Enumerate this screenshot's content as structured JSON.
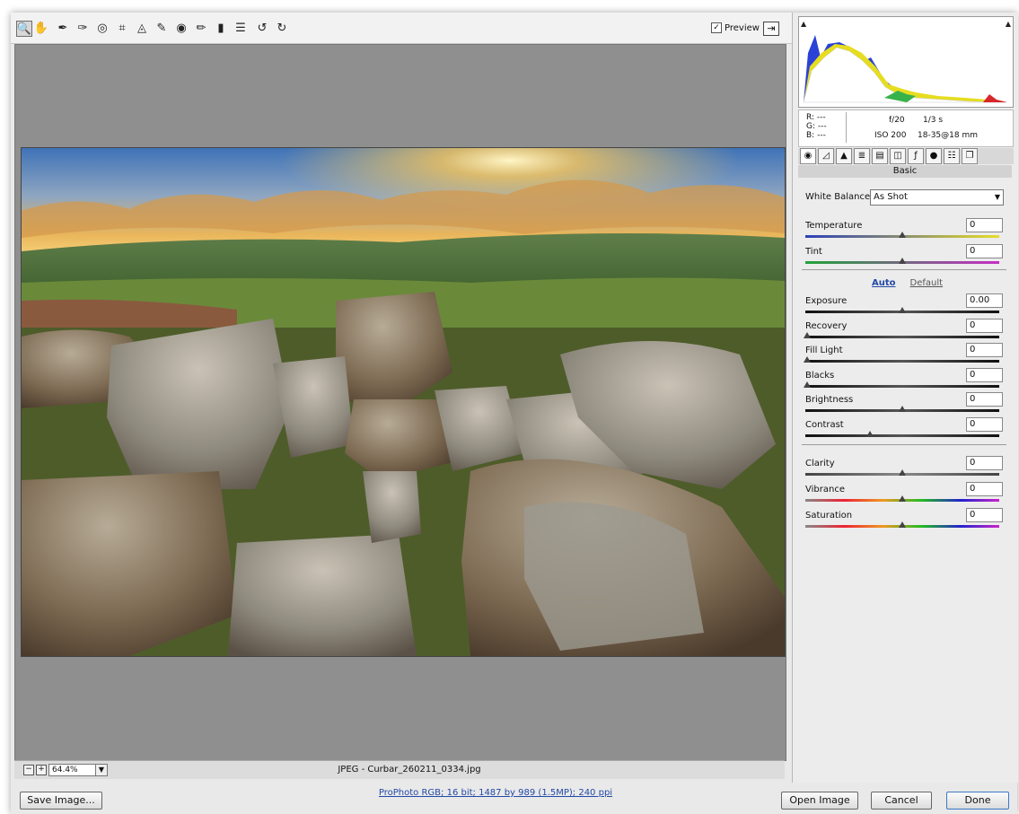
{
  "toolbar": {
    "tools": [
      {
        "icon": "zoom-icon",
        "glyph": "🔍"
      },
      {
        "icon": "hand-icon",
        "glyph": "✋"
      },
      {
        "icon": "white-balance-icon",
        "glyph": "✒"
      },
      {
        "icon": "color-sampler-icon",
        "glyph": "✑"
      },
      {
        "icon": "target-adjust-icon",
        "glyph": "◎"
      },
      {
        "icon": "crop-icon",
        "glyph": "⌗"
      },
      {
        "icon": "straighten-icon",
        "glyph": "◬"
      },
      {
        "icon": "spot-removal-icon",
        "glyph": "✎"
      },
      {
        "icon": "red-eye-icon",
        "glyph": "◉"
      },
      {
        "icon": "adjustment-brush-icon",
        "glyph": "✏"
      },
      {
        "icon": "graduated-filter-icon",
        "glyph": "▮"
      },
      {
        "icon": "preferences-icon",
        "glyph": "☰"
      },
      {
        "icon": "rotate-left-icon",
        "glyph": "↺"
      },
      {
        "icon": "rotate-right-icon",
        "glyph": "↻"
      }
    ],
    "preview_label": "Preview",
    "preview_checked": "✓"
  },
  "status": {
    "zoom_value": "64.4%",
    "file_label": "JPEG  -  Curbar_260211_0334.jpg"
  },
  "footer": {
    "save_label": "Save Image...",
    "workflow_info": "ProPhoto RGB; 16 bit; 1487 by 989 (1.5MP); 240 ppi",
    "open_label": "Open Image",
    "cancel_label": "Cancel",
    "done_label": "Done"
  },
  "info": {
    "r": "R:  ---",
    "g": "G:  ---",
    "b": "B:  ---",
    "aperture": "f/20",
    "shutter": "1/3 s",
    "iso": "ISO 200",
    "lens": "18-35@18 mm"
  },
  "panel": {
    "title": "Basic",
    "white_balance_label": "White Balance:",
    "white_balance_value": "As Shot",
    "auto_label": "Auto",
    "default_label": "Default"
  },
  "controls": [
    {
      "key": "temperature",
      "label": "Temperature",
      "value": "0",
      "level": 0.5
    },
    {
      "key": "tint",
      "label": "Tint",
      "value": "0",
      "level": 0.5
    },
    {
      "key": "exposure",
      "label": "Exposure",
      "value": "0.00",
      "level": 0.5
    },
    {
      "key": "recovery",
      "label": "Recovery",
      "value": "0",
      "level": 0
    },
    {
      "key": "fill-light",
      "label": "Fill Light",
      "value": "0",
      "level": 0
    },
    {
      "key": "blacks",
      "label": "Blacks",
      "value": "0",
      "level": 0
    },
    {
      "key": "brightness",
      "label": "Brightness",
      "value": "0",
      "level": 0.5
    },
    {
      "key": "contrast",
      "label": "Contrast",
      "value": "0",
      "level": 0.33
    },
    {
      "key": "clarity",
      "label": "Clarity",
      "value": "0",
      "level": 0.5
    },
    {
      "key": "vibrance",
      "label": "Vibrance",
      "value": "0",
      "level": 0.5
    },
    {
      "key": "saturation",
      "label": "Saturation",
      "value": "0",
      "level": 0.5
    }
  ]
}
